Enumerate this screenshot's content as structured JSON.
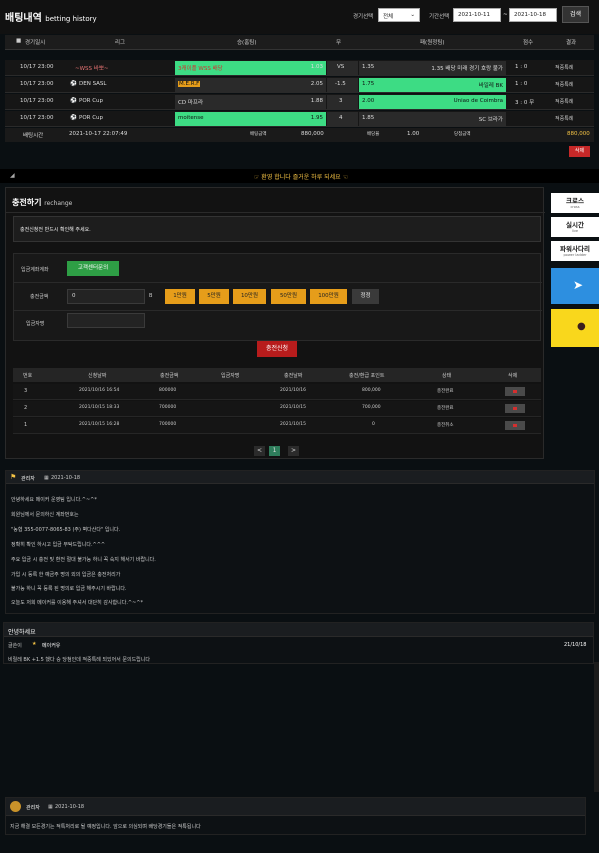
{
  "header": {
    "title": "배팅내역",
    "title_sub": "betting history",
    "game_select_label": "경기선택",
    "game_select_value": "전체",
    "period_label": "기간선택",
    "date_from": "2021-10-11",
    "date_sep": "~",
    "date_to": "2021-10-18",
    "search_label": "검색"
  },
  "bet_table": {
    "headers": [
      "경기일시",
      "리그",
      "승(홈팀)",
      "무",
      "패(원정팀)",
      "점수",
      "결과"
    ],
    "rows": [
      {
        "date": "10/17 23:00",
        "league": "~WSS 바뽀~",
        "home": "3캐이플 WSS 배당",
        "home_odds": "1.03",
        "draw": "VS",
        "away_odds": "1.35",
        "away": "1.35 배당 미래 경기 호랑 불가",
        "score": "1 : 0",
        "result": "적중특례"
      },
      {
        "date": "10/17 23:00",
        "league": "DEN SASL",
        "home": "M.E.R.F",
        "home_odds": "2.05",
        "draw": "-1.5",
        "away_odds": "1.75",
        "away": "바일레 BK",
        "score": "1 : 0",
        "result": "적중특례"
      },
      {
        "date": "10/17 23:00",
        "league": "POR Cup",
        "home": "CD 마프라",
        "home_odds": "1.88",
        "draw": "3",
        "away_odds": "2.00",
        "away": "Uniao de Coimbra",
        "score": "3 : 0 무",
        "result": "적중특례"
      },
      {
        "date": "10/17 23:00",
        "league": "POR Cup",
        "home": "moitense",
        "home_odds": "1.95",
        "draw": "4",
        "away_odds": "1.85",
        "away": "SC 브라가",
        "score": "",
        "result": "적중특례"
      }
    ],
    "summary": {
      "bet_time_label": "배팅시간",
      "bet_time": "2021-10-17 22:07:49",
      "bet_amount_label": "배팅금액",
      "bet_amount": "880,000",
      "odds_label": "배당율",
      "odds": "1.00",
      "win_amount_label": "당첨금액",
      "win_amount": "880,000"
    },
    "delete_label": "삭제"
  },
  "banner": {
    "text": "환영 합니다 즐거운 하루 되세요"
  },
  "recharge": {
    "title": "충전하기",
    "title_sub": "rechange",
    "notice": "충전신청전 반드시 확인해 주세요.",
    "account_label": "입금계좌계좌",
    "account_btn": "고객센터문의",
    "amount_label": "충전금액",
    "amount_value": "0",
    "amount_unit": "B",
    "quick_amounts": [
      "1만원",
      "5만원",
      "10만원",
      "50만원",
      "100만원"
    ],
    "reset_label": "정정",
    "depositor_label": "입금자명",
    "apply_label": "충전신청",
    "list_headers": [
      "번호",
      "신청날짜",
      "충전금액",
      "입금자명",
      "충전날짜",
      "충전/환급 포인트",
      "상태",
      "삭제"
    ],
    "list_rows": [
      {
        "no": "3",
        "req_date": "2021/10/16 16:54",
        "amount": "800000",
        "name": "",
        "done_date": "2021/10/16",
        "points": "800,000",
        "status": "충전완료"
      },
      {
        "no": "2",
        "req_date": "2021/10/15 18:33",
        "amount": "700000",
        "name": "",
        "done_date": "2021/10/15",
        "points": "700,000",
        "status": "충전완료"
      },
      {
        "no": "1",
        "req_date": "2021/10/15 16:28",
        "amount": "700000",
        "name": "",
        "done_date": "2021/10/15",
        "points": "0",
        "status": "충전취소"
      }
    ],
    "pager": [
      "<",
      "1",
      ">"
    ]
  },
  "side": [
    {
      "title": "크로스",
      "sub": "cross"
    },
    {
      "title": "실시간",
      "sub": "live"
    },
    {
      "title": "파워사다리",
      "sub": "power ladder"
    }
  ],
  "notice1": {
    "author": "관리자",
    "date": "2021-10-18",
    "lines": [
      "안녕하세요 메이커 운영팀 입니다.^~^*",
      "회원님께서 문의하신 계좌번호는",
      "\"농협 355-0077-8065-83 (주) 벽다산다\" 입니다.",
      "정확히 확인 하시고 입금 부탁드립니다.^^^",
      "주요 입금 시 충전 및 환전 절대 불가능 하니 꼭 숙지 해서기 바랍니다.",
      "가입 시 등록 한 예금주 명의 외의 입금은 충전처리가",
      "불가능 하니 꼭 등록 된 명의로 입금 해주시기 바랍니다.",
      "오늘도 저희 메이커를 이용해 주셔서 대단히 감사합니다.^~^*"
    ]
  },
  "notice2": {
    "title": "안녕하세요",
    "writer_label": "글쓴이",
    "writer": "메이커유",
    "date": "21/10/18",
    "body": "비릴레 BK +1.5 했다 승 당첨인데 적중특례 되있어서 문의드립니다"
  },
  "notice3": {
    "author": "관리자",
    "date": "2021-10-18",
    "body": "지금 해결 모든경기는 적특처리로 될 예정입니다. 앞으로 의심되며 배당경기들은 적특됩니다"
  }
}
